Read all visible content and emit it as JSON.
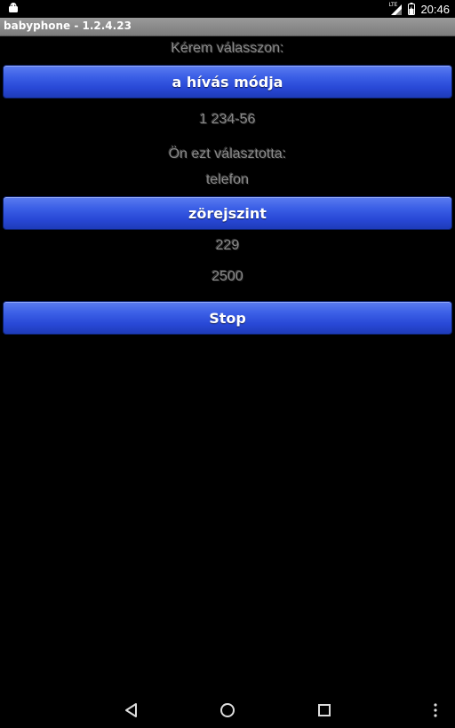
{
  "status_bar": {
    "network_label": "LTE",
    "time": "20:46"
  },
  "app": {
    "title": "babyphone - 1.2.4.23"
  },
  "main": {
    "prompt_label": "Kérem válasszon:",
    "call_mode_button_label": "a hívás módja",
    "phone_number": "1 234-56",
    "selected_label": "Ön ezt választotta:",
    "selected_value": "telefon",
    "noise_level_button_label": "zörejszint",
    "noise_value": "229",
    "threshold_value": "2500",
    "stop_button_label": "Stop"
  },
  "navigation": {
    "back": "back-icon",
    "home": "home-icon",
    "recents": "recents-icon",
    "menu": "overflow-menu-icon"
  },
  "colors": {
    "button_blue": "#2848d6",
    "title_bar_gray": "#8a8a8a",
    "label_gray": "#8c8c8c"
  }
}
